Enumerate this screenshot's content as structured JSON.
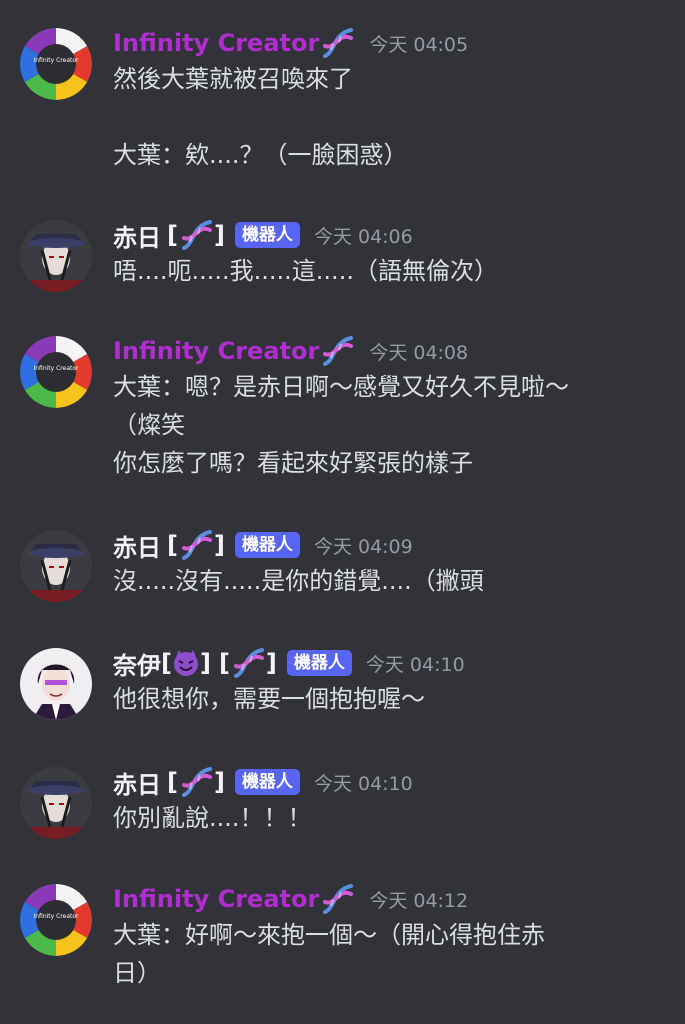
{
  "messages": [
    {
      "username": "Infinity Creator",
      "timestamp": "今天 04:05",
      "avatar_text": "Infinity Creator",
      "lines": [
        "然後大葉就被召喚來了",
        "",
        "大葉：欸....？（一臉困惑）"
      ]
    },
    {
      "username": "赤日",
      "badge": "機器人",
      "timestamp": "今天 04:06",
      "lines": [
        "唔....呃.....我.....這.....（語無倫次）"
      ]
    },
    {
      "username": "Infinity Creator",
      "timestamp": "今天 04:08",
      "avatar_text": "Infinity Creator",
      "lines": [
        "大葉：嗯？是赤日啊～感覺又好久不見啦～",
        "（燦笑",
        "你怎麼了嗎？看起來好緊張的樣子"
      ]
    },
    {
      "username": "赤日",
      "badge": "機器人",
      "timestamp": "今天 04:09",
      "lines": [
        "沒.....沒有.....是你的錯覺....（撇頭"
      ]
    },
    {
      "username": "奈伊",
      "badge": "機器人",
      "timestamp": "今天 04:10",
      "lines": [
        "他很想你，需要一個抱抱喔～"
      ]
    },
    {
      "username": "赤日",
      "badge": "機器人",
      "timestamp": "今天 04:10",
      "lines": [
        "你別亂說....！！！"
      ]
    },
    {
      "username": "Infinity Creator",
      "timestamp": "今天 04:12",
      "avatar_text": "Infinity Creator",
      "lines": [
        "大葉：好啊～來抱一個～（開心得抱住赤",
        "日）"
      ]
    }
  ],
  "brackets": {
    "open": "[",
    "close": "]"
  },
  "colors": {
    "background": "#313338",
    "creator_name": "#b02dd0",
    "bot_badge": "#5865f2",
    "timestamp": "#949ba4",
    "text": "#dbdee1"
  },
  "icons": {
    "dna": "dna-icon",
    "devil": "smiling-devil-emoji"
  }
}
